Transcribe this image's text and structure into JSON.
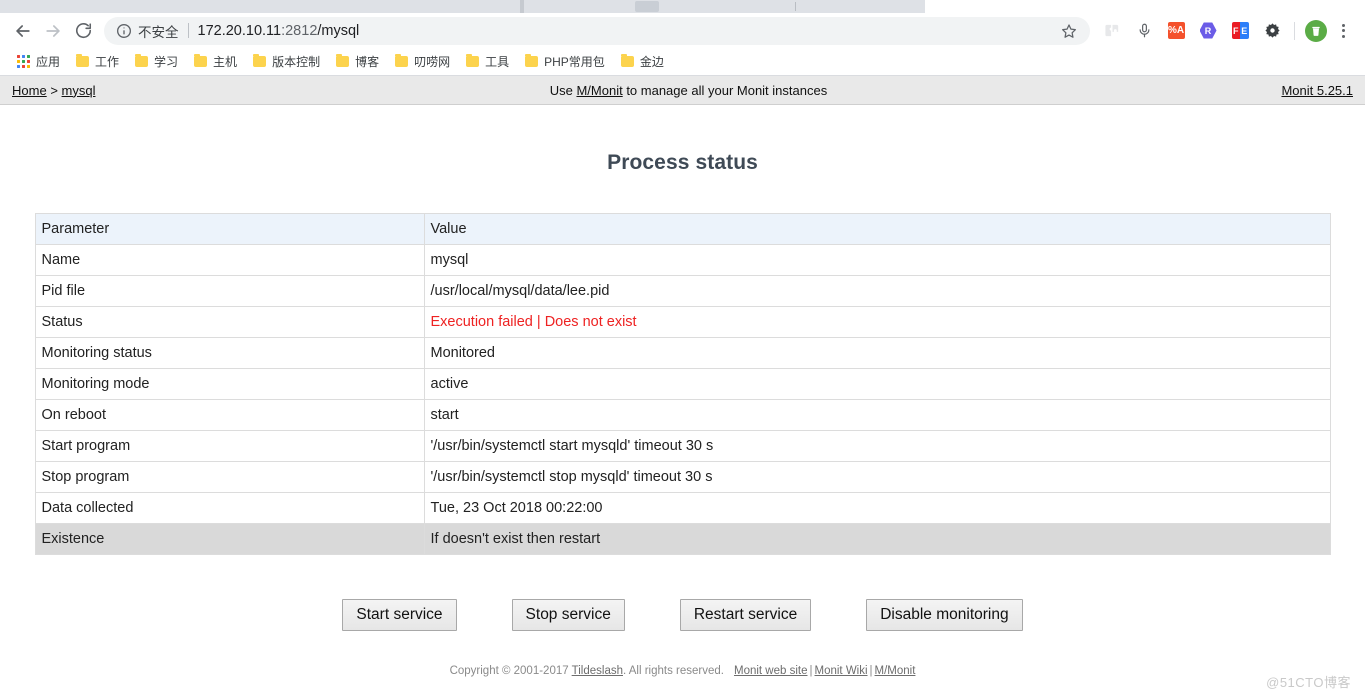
{
  "browser": {
    "nav": {
      "back_label": "Back",
      "forward_label": "Forward",
      "reload_label": "Reload"
    },
    "omnibox": {
      "security_icon": "info-circle-icon",
      "security_label": "不安全",
      "url_host": "172.20.10.11",
      "url_port": ":2812",
      "url_path": "/mysql",
      "url_full": "172.20.10.11:2812/mysql",
      "bookmark_icon": "star-icon"
    },
    "extensions": [
      {
        "name": "puzzle-extension-icon",
        "glyph": "puzzle",
        "bg": "#e8eaed",
        "fg": "#d4d6d9",
        "label": ""
      },
      {
        "name": "microphone-icon",
        "glyph": "mic",
        "bg": "",
        "fg": "#5f6368",
        "label": ""
      },
      {
        "name": "percent-a-extension-icon",
        "glyph": "box",
        "bg": "#f4512c",
        "fg": "#ffffff",
        "label": "%A"
      },
      {
        "name": "r-hexagon-extension-icon",
        "glyph": "hex",
        "bg": "#6b5ce7",
        "fg": "#ffffff",
        "label": "R"
      },
      {
        "name": "fe-extension-icon",
        "glyph": "split",
        "bg": "#ea1c24",
        "bg2": "#2d7ff9",
        "fg": "#ffffff",
        "label": "FE",
        "label_l": "F",
        "label_r": "E"
      },
      {
        "name": "bug-gear-extension-icon",
        "glyph": "gear",
        "bg": "",
        "fg": "#3c4043",
        "label": ""
      }
    ],
    "avatar": {
      "name": "profile-avatar",
      "color": "#5bac46"
    },
    "menu": {
      "name": "chrome-menu-icon"
    },
    "bookmarks": [
      {
        "label": "应用",
        "icon": "apps-grid-icon"
      },
      {
        "label": "工作",
        "icon": "folder-icon"
      },
      {
        "label": "学习",
        "icon": "folder-icon"
      },
      {
        "label": "主机",
        "icon": "folder-icon"
      },
      {
        "label": "版本控制",
        "icon": "folder-icon"
      },
      {
        "label": "博客",
        "icon": "folder-icon"
      },
      {
        "label": "叨唠网",
        "icon": "folder-icon"
      },
      {
        "label": "工具",
        "icon": "folder-icon"
      },
      {
        "label": "PHP常用包",
        "icon": "folder-icon"
      },
      {
        "label": "金边",
        "icon": "folder-icon"
      }
    ]
  },
  "monit": {
    "header": {
      "breadcrumb_home": "Home",
      "breadcrumb_sep": ">",
      "breadcrumb_current": "mysql",
      "center_prefix": "Use ",
      "center_link": "M/Monit",
      "center_suffix": " to manage all your Monit instances",
      "version": "Monit 5.25.1"
    },
    "page_title": "Process status",
    "table": {
      "columns": [
        "Parameter",
        "Value"
      ],
      "rows": [
        {
          "parameter": "Name",
          "value": "mysql",
          "red": false,
          "highlight": false
        },
        {
          "parameter": "Pid file",
          "value": "/usr/local/mysql/data/lee.pid",
          "red": false,
          "highlight": false
        },
        {
          "parameter": "Status",
          "value": "Execution failed | Does not exist",
          "red": true,
          "highlight": false
        },
        {
          "parameter": "Monitoring status",
          "value": "Monitored",
          "red": false,
          "highlight": false
        },
        {
          "parameter": "Monitoring mode",
          "value": "active",
          "red": false,
          "highlight": false
        },
        {
          "parameter": "On reboot",
          "value": "start",
          "red": false,
          "highlight": false
        },
        {
          "parameter": "Start program",
          "value": "'/usr/bin/systemctl start mysqld' timeout 30 s",
          "red": false,
          "highlight": false
        },
        {
          "parameter": "Stop program",
          "value": "'/usr/bin/systemctl stop mysqld' timeout 30 s",
          "red": false,
          "highlight": false
        },
        {
          "parameter": "Data collected",
          "value": "Tue, 23 Oct 2018 00:22:00",
          "red": false,
          "highlight": false
        },
        {
          "parameter": "Existence",
          "value": "If doesn't exist then restart",
          "red": false,
          "highlight": true
        }
      ]
    },
    "buttons": [
      {
        "label": "Start service",
        "name": "start-service-button"
      },
      {
        "label": "Stop service",
        "name": "stop-service-button"
      },
      {
        "label": "Restart service",
        "name": "restart-service-button"
      },
      {
        "label": "Disable monitoring",
        "name": "disable-monitoring-button"
      }
    ],
    "footer": {
      "copyright_pre": "Copyright © 2001-2017 ",
      "copyright_link": "Tildeslash",
      "copyright_post": ". All rights reserved.",
      "links": [
        "Monit web site",
        "Monit Wiki",
        "M/Monit"
      ],
      "link_sep": "|"
    }
  },
  "watermark": "@51CTO博客",
  "colors": {
    "status_red": "#ee2222",
    "header_bg": "#e9e9e9",
    "table_header_bg": "#ecf3fb",
    "highlight_row_bg": "#d9d9d9",
    "title_color": "#3f4a56"
  }
}
